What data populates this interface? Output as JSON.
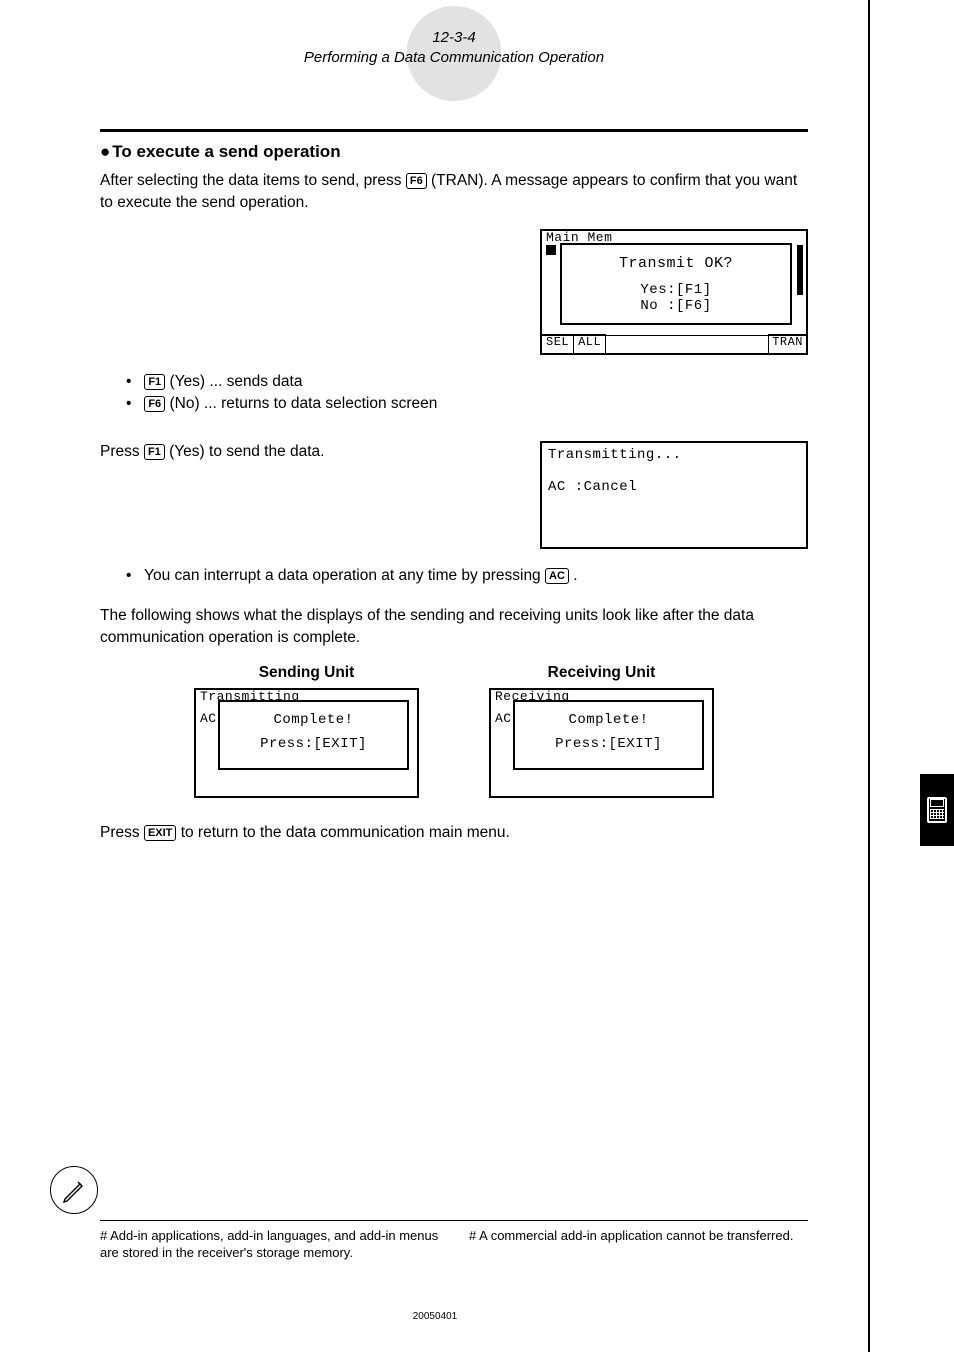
{
  "header": {
    "page_ref": "12-3-4",
    "subtitle": "Performing a Data Communication Operation"
  },
  "section": {
    "title": "To execute a send operation",
    "intro_before_key": "After selecting the data items to send, press ",
    "intro_key": "F6",
    "intro_key_label": "(TRAN). A message appears to confirm that you want to execute the send operation."
  },
  "confirm_screen": {
    "top_line": "Main Mem",
    "prompt": "Transmit OK?",
    "yes": "Yes:[F1]",
    "no": "No :[F6]",
    "softkeys_left": "SEL",
    "softkeys_mid": "ALL",
    "softkeys_right": "TRAN"
  },
  "options": {
    "f1_key": "F1",
    "f1_text": "(Yes) ... sends data",
    "f6_key": "F6",
    "f6_text": "(No) ... returns to data selection screen"
  },
  "press_line": {
    "before": "Press ",
    "key": "F1",
    "after": "(Yes) to send the data."
  },
  "transmitting_screen": {
    "line1": "Transmitting...",
    "line2": "AC :Cancel"
  },
  "interrupt": {
    "before": "You can interrupt a data operation at any time by pressing ",
    "key": "AC",
    "after": "."
  },
  "followup": "The following shows what the displays of the sending and receiving units look like after the data communication operation is complete.",
  "units": {
    "sending_title": "Sending Unit",
    "receiving_title": "Receiving Unit",
    "sending_bg1": "Transmitting",
    "sending_bg2": "AC",
    "receiving_bg1": "Receiving",
    "receiving_bg2": "AC",
    "complete": "Complete!",
    "press_exit": "Press:[EXIT]"
  },
  "return_line": {
    "before": "Press ",
    "key": "EXIT",
    "after": " to return to the data communication main menu."
  },
  "footnotes": {
    "left": "# Add-in applications, add-in languages, and add-in menus are stored in the receiver's storage memory.",
    "right": "# A commercial add-in application cannot be transferred."
  },
  "page_code": "20050401"
}
